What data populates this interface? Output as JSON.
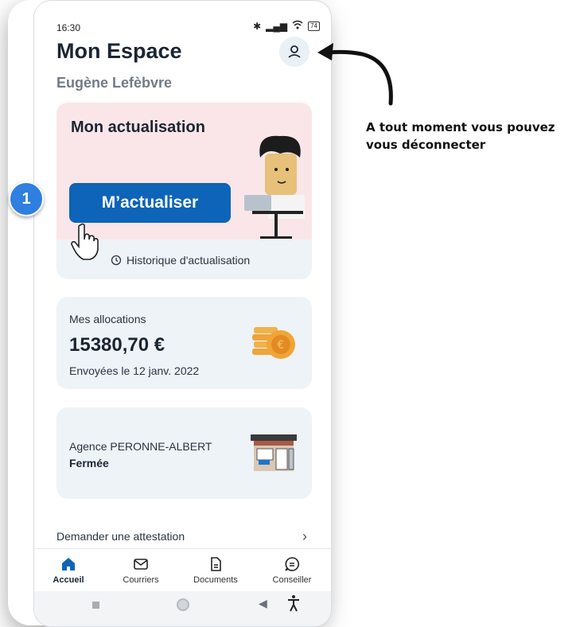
{
  "status_bar": {
    "time": "16:30",
    "battery": "74"
  },
  "header": {
    "title": "Mon Espace",
    "user_name": "Eugène Lefèbvre"
  },
  "actualisation": {
    "title": "Mon actualisation",
    "button_label": "M’actualiser",
    "history_label": "Historique d'actualisation"
  },
  "allocations": {
    "label": "Mes allocations",
    "amount": "15380,70 €",
    "sent_date": "Envoyées le 12 janv. 2022"
  },
  "agence": {
    "name": "Agence PERONNE-ALBERT",
    "status": "Fermée"
  },
  "attestation": {
    "label": "Demander une attestation"
  },
  "tabs": [
    {
      "label": "Accueil",
      "icon": "home-icon",
      "active": true
    },
    {
      "label": "Courriers",
      "icon": "mail-icon"
    },
    {
      "label": "Documents",
      "icon": "document-icon"
    },
    {
      "label": "Conseiller",
      "icon": "chat-icon"
    }
  ],
  "tutorial": {
    "step_number": "1",
    "annotation": "A tout moment vous pouvez vous déconnecter"
  },
  "colors": {
    "primary": "#0d64b8",
    "card_bg": "#eef3f7",
    "pink_bg": "#fae6e8",
    "badge": "#2f7fe0"
  }
}
